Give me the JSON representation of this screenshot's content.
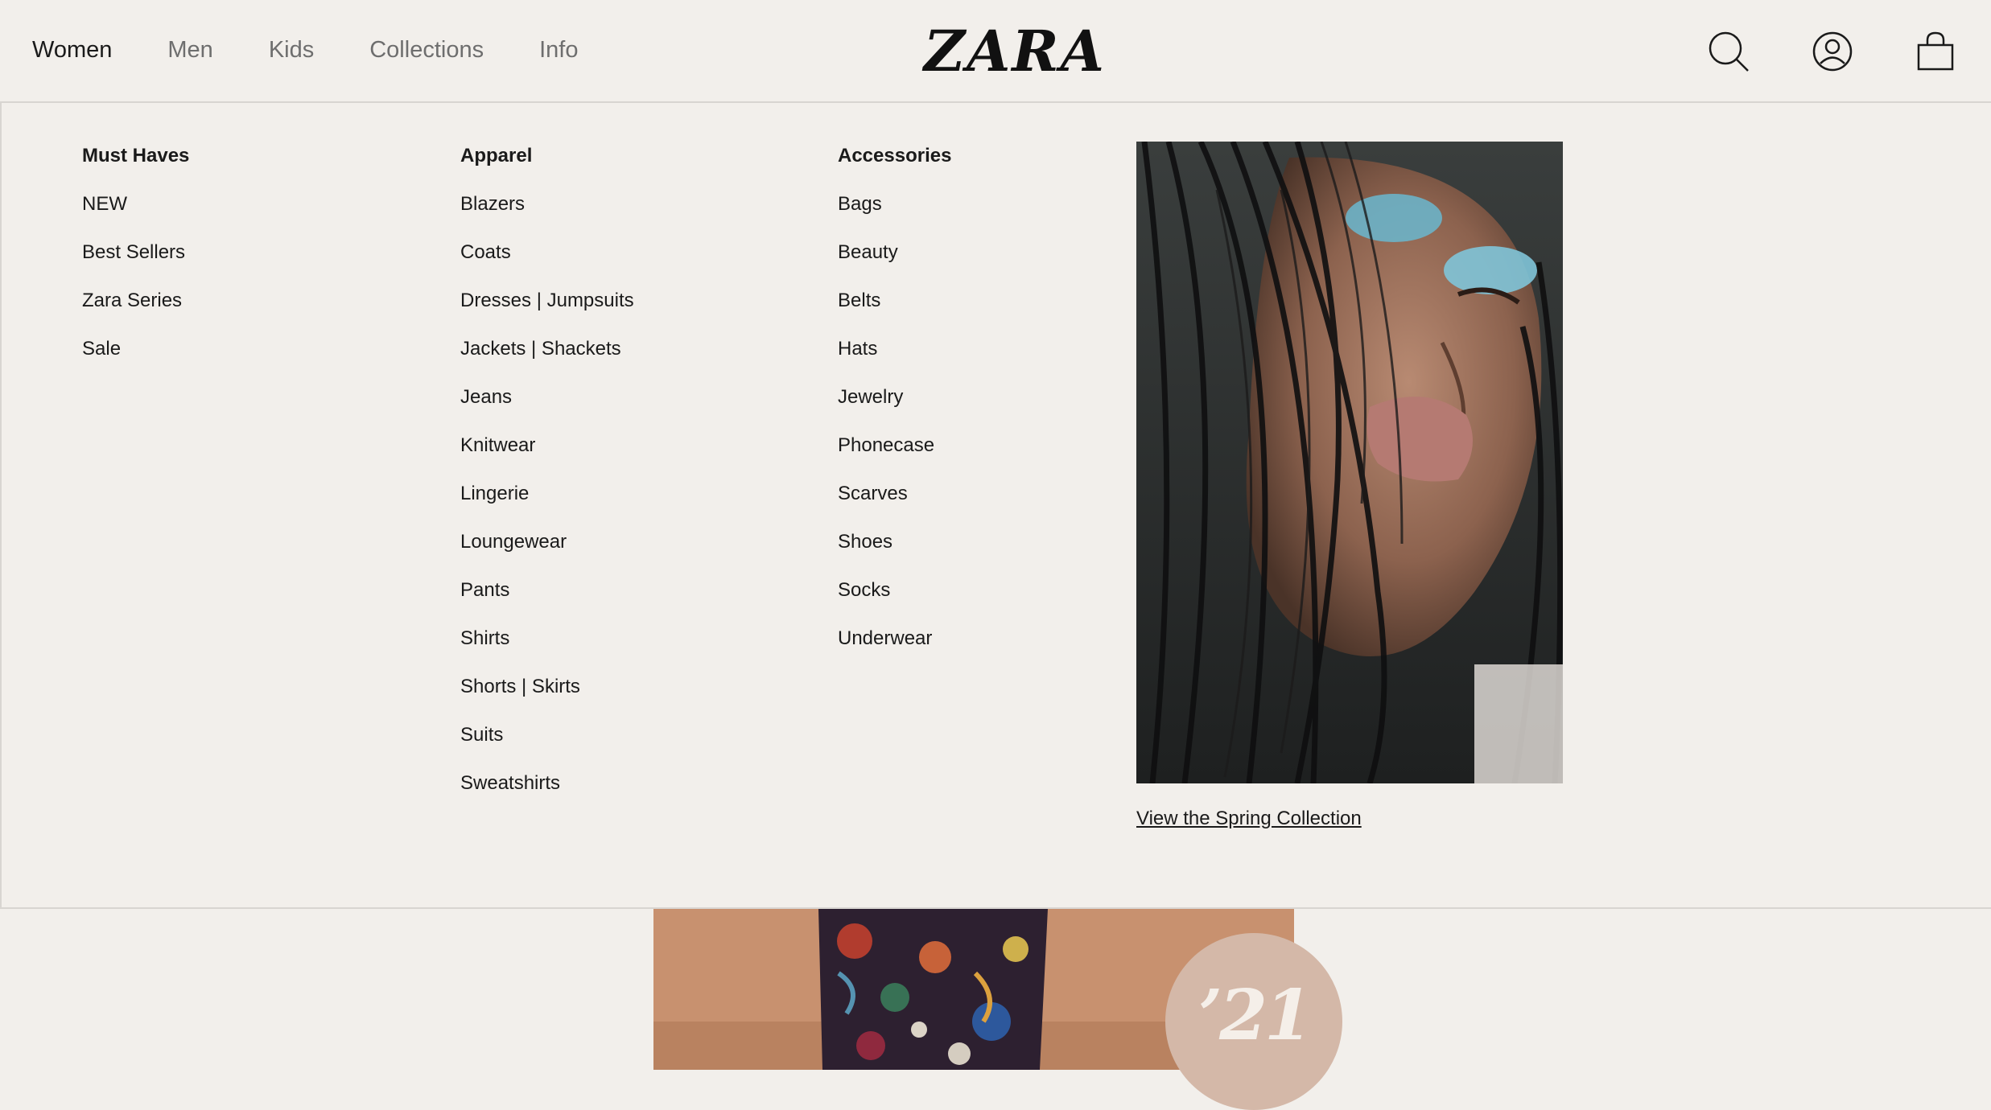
{
  "header": {
    "nav": [
      "Women",
      "Men",
      "Kids",
      "Collections",
      "Info"
    ],
    "logo": "ZARA",
    "icons": [
      "search-icon",
      "account-icon",
      "bag-icon"
    ]
  },
  "menu": {
    "col1": {
      "heading": "Must Haves",
      "items": [
        "NEW",
        "Best Sellers",
        "Zara Series",
        "Sale"
      ]
    },
    "col2": {
      "heading": "Apparel",
      "items": [
        "Blazers",
        "Coats",
        "Dresses | Jumpsuits",
        "Jackets | Shackets",
        "Jeans",
        "Knitwear",
        "Lingerie",
        "Loungewear",
        "Pants",
        "Shirts",
        "Shorts | Skirts",
        "Suits",
        "Sweatshirts"
      ]
    },
    "col3": {
      "heading": "Accessories",
      "items": [
        "Bags",
        "Beauty",
        "Belts",
        "Hats",
        "Jewelry",
        "Phonecase",
        "Scarves",
        "Shoes",
        "Socks",
        "Underwear"
      ]
    },
    "promo": {
      "link": "View the Spring Collection"
    }
  },
  "hero": {
    "badge": "’21"
  },
  "colors": {
    "background": "#f2efeb",
    "text": "#1a1a1a",
    "nav_inactive": "#6e6e6e",
    "badge": "#d4b8a8",
    "hero": "#c89272"
  }
}
